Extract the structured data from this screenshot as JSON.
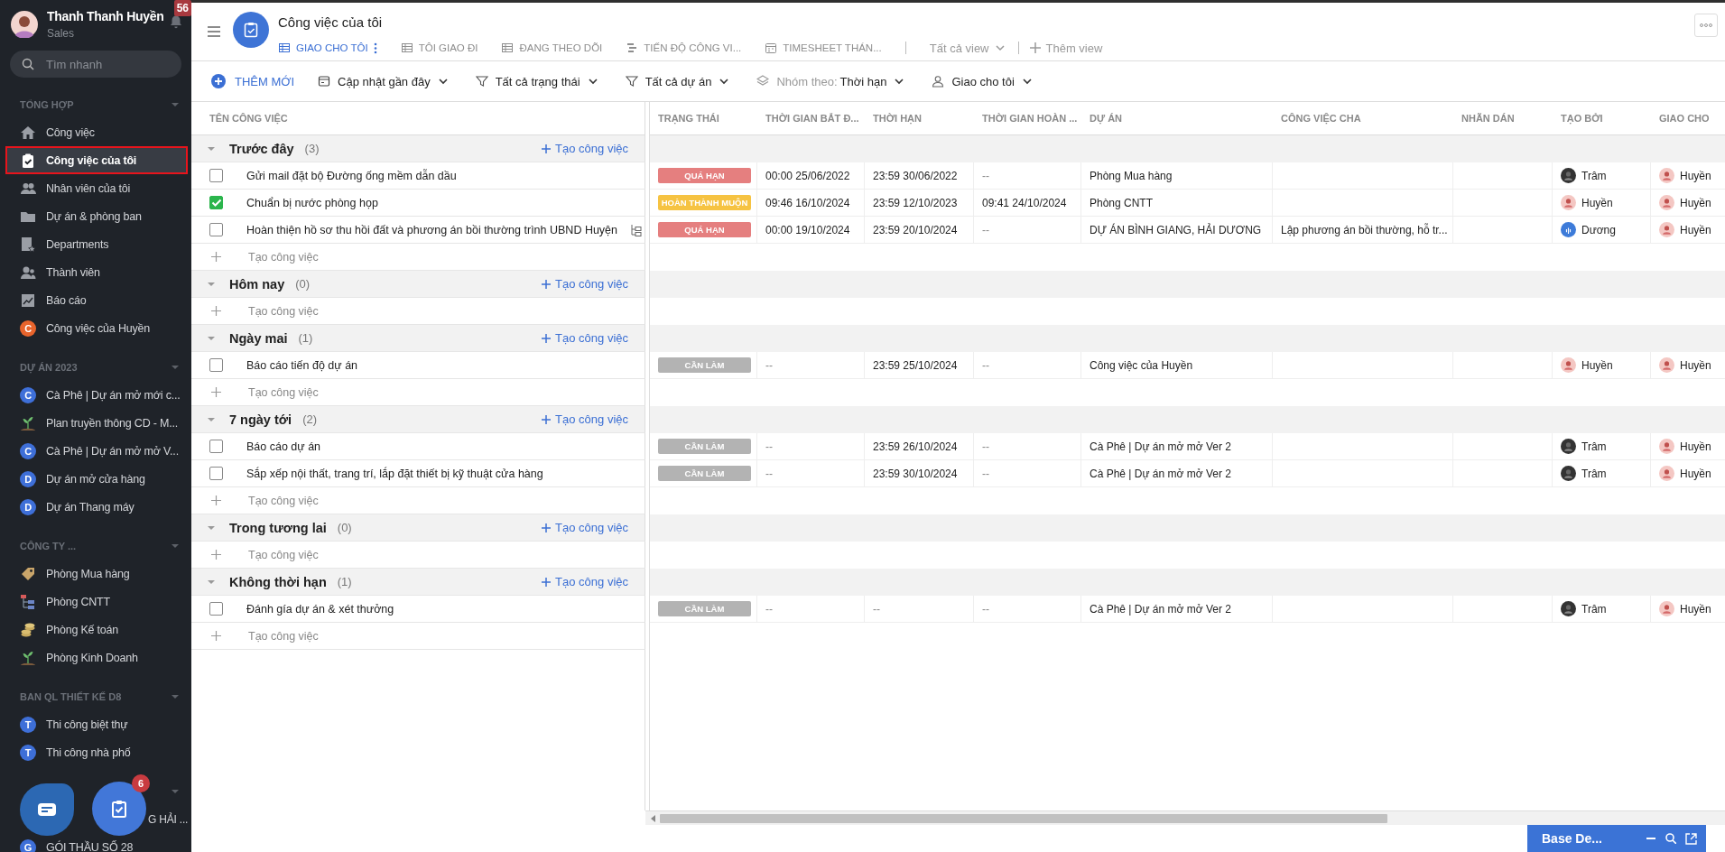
{
  "sidebar": {
    "user": {
      "name": "Thanh Thanh Huyền",
      "role": "Sales"
    },
    "notifications": "56",
    "search": {
      "placeholder": "Tìm nhanh"
    },
    "sections": [
      {
        "title": "TỔNG HỢP",
        "expanded": true,
        "items": [
          {
            "label": "Công việc",
            "kind": "home",
            "selected": false
          },
          {
            "label": "Công việc của tôi",
            "kind": "task",
            "selected": true
          },
          {
            "label": "Nhân viên của tôi",
            "kind": "people",
            "selected": false
          },
          {
            "label": "Dự án & phòng ban",
            "kind": "folder",
            "selected": false
          },
          {
            "label": "Departments",
            "kind": "dept",
            "selected": false
          },
          {
            "label": "Thành viên",
            "kind": "member",
            "selected": false
          },
          {
            "label": "Báo cáo",
            "kind": "report",
            "selected": false
          },
          {
            "label": "Công việc của Huyền",
            "kind": "letter",
            "badge": "C",
            "color": "#e8642c",
            "selected": false
          }
        ]
      },
      {
        "title": "DỰ ÁN 2023",
        "expanded": true,
        "items": [
          {
            "label": "Cà Phê | Dự án mở mới c...",
            "kind": "letter",
            "badge": "C",
            "color": "#3e6fd8",
            "selected": false
          },
          {
            "label": "Plan truyền thông CD - M...",
            "kind": "plant",
            "selected": false
          },
          {
            "label": "Cà Phê | Dự án mở mở V...",
            "kind": "letter",
            "badge": "C",
            "color": "#3e6fd8",
            "selected": false
          },
          {
            "label": "Dự án mở cửa hàng",
            "kind": "letter",
            "badge": "D",
            "color": "#3e6fd8",
            "selected": false
          },
          {
            "label": "Dự án Thang máy",
            "kind": "letter",
            "badge": "D",
            "color": "#3e6fd8",
            "selected": false
          }
        ]
      },
      {
        "title": "CÔNG TY ...",
        "expanded": true,
        "items": [
          {
            "label": "Phòng Mua hàng",
            "kind": "tag",
            "selected": false
          },
          {
            "label": "Phòng CNTT",
            "kind": "org",
            "selected": false
          },
          {
            "label": "Phòng Kế toán",
            "kind": "coins",
            "selected": false
          },
          {
            "label": "Phòng Kinh Doanh",
            "kind": "plant",
            "selected": false
          }
        ]
      },
      {
        "title": "BAN QL THIẾT KẾ D8",
        "expanded": true,
        "items": [
          {
            "label": "Thi công biệt thự",
            "kind": "letter",
            "badge": "T",
            "color": "#3e6fd8",
            "selected": false
          },
          {
            "label": "Thi công nhà phố",
            "kind": "letter",
            "badge": "T",
            "color": "#3e6fd8",
            "selected": false
          }
        ]
      },
      {
        "expanded": true,
        "items": [
          {
            "label": "G HẢI ...",
            "kind": "covered",
            "selected": false
          },
          {
            "label": "GÓI THẦU SỐ 28",
            "kind": "letter",
            "badge": "G",
            "color": "#3e6fd8",
            "selected": false
          }
        ]
      }
    ]
  },
  "floating": {
    "task_badge": "6"
  },
  "header": {
    "title": "Công việc của tôi",
    "tabs": [
      {
        "label": "GIAO CHO TÔI",
        "kind": "table",
        "selected": true
      },
      {
        "label": "TÔI GIAO ĐI",
        "kind": "table",
        "selected": false
      },
      {
        "label": "ĐANG THEO DÕI",
        "kind": "table",
        "selected": false
      },
      {
        "label": "TIẾN ĐỘ CÔNG VI...",
        "kind": "gantt",
        "selected": false
      },
      {
        "label": "TIMESHEET THÁN...",
        "kind": "calendar",
        "selected": false
      }
    ],
    "view_menu": "Tất cả view",
    "add_view": "Thêm view"
  },
  "toolbar": {
    "add_button": "THÊM MỚI",
    "filters": [
      {
        "kind": "calendar",
        "label": "Cập nhật gần đây"
      },
      {
        "kind": "filter",
        "label": "Tất cả trạng thái"
      },
      {
        "kind": "filter",
        "label": "Tất cả dự án"
      },
      {
        "kind": "group",
        "prefix": "Nhóm theo:",
        "label": "Thời hạn"
      },
      {
        "kind": "person",
        "label": "Giao cho tôi"
      }
    ]
  },
  "table": {
    "columns": [
      "TÊN CÔNG VIỆC",
      "TRẠNG THÁI",
      "THỜI GIAN BẮT Đ...",
      "THỜI HẠN",
      "THỜI GIAN HOÀN ...",
      "DỰ ÁN",
      "CÔNG VIỆC CHA",
      "NHÃN DÁN",
      "TẠO BỞI",
      "GIAO CHO"
    ],
    "groups": [
      {
        "title": "Trước đây",
        "count": "(3)",
        "expanded": true,
        "add_link": "Tạo công việc",
        "add_placeholder": "Tạo công việc",
        "tasks": [
          {
            "name": "Gửi mail đặt bộ Đường ống mềm dẫn dầu",
            "checked": false,
            "status": {
              "label": "QUÁ HẠN",
              "color": "#e57f7f"
            },
            "start": "00:00 25/06/2022",
            "deadline": "23:59 30/06/2022",
            "completed": "--",
            "project": "Phòng Mua hàng",
            "created_by": {
              "name": "Trâm",
              "color": "#333333"
            },
            "assignee": {
              "name": "Huyền",
              "color": "#f4c7c3"
            }
          },
          {
            "name": "Chuẩn bị nước phòng họp",
            "checked": true,
            "status": {
              "label": "HOÀN THÀNH MUỘN",
              "color": "#f6c342"
            },
            "start": "09:46 16/10/2024",
            "deadline": "23:59 12/10/2023",
            "completed": "09:41 24/10/2024",
            "project": "Phòng CNTT",
            "created_by": {
              "name": "Huyền",
              "color": "#f4c7c3"
            },
            "assignee": {
              "name": "Huyền",
              "color": "#f4c7c3"
            }
          },
          {
            "name": "Hoàn thiện hồ sơ thu hồi đất và phương án bồi thường trình UBND Huyện",
            "checked": false,
            "subtasks": true,
            "status": {
              "label": "QUÁ HẠN",
              "color": "#e57f7f"
            },
            "start": "00:00 19/10/2024",
            "deadline": "23:59 20/10/2024",
            "completed": "--",
            "project": "DỰ ÁN BÌNH GIANG, HẢI DƯƠNG",
            "parent": "Lập phương án bồi thường, hỗ tr...",
            "created_by": {
              "name": "Dương",
              "color": "#3d7bd9"
            },
            "assignee": {
              "name": "Huyền",
              "color": "#f4c7c3"
            }
          }
        ]
      },
      {
        "title": "Hôm nay",
        "count": "(0)",
        "expanded": true,
        "add_link": "Tạo công việc",
        "add_placeholder": "Tạo công việc"
      },
      {
        "title": "Ngày mai",
        "count": "(1)",
        "expanded": true,
        "add_link": "Tạo công việc",
        "add_placeholder": "Tạo công việc",
        "tasks": [
          {
            "name": "Báo cáo tiến độ dự án",
            "checked": false,
            "status": {
              "label": "CẦN LÀM",
              "color": "#b3b3b3"
            },
            "start": "--",
            "deadline": "23:59 25/10/2024",
            "completed": "--",
            "project": "Công việc của Huyền",
            "created_by": {
              "name": "Huyền",
              "color": "#f4c7c3"
            },
            "assignee": {
              "name": "Huyền",
              "color": "#f4c7c3"
            }
          }
        ]
      },
      {
        "title": "7 ngày tới",
        "count": "(2)",
        "expanded": true,
        "add_link": "Tạo công việc",
        "add_placeholder": "Tạo công việc",
        "tasks": [
          {
            "name": "Báo cáo dự án",
            "checked": false,
            "status": {
              "label": "CẦN LÀM",
              "color": "#b3b3b3"
            },
            "start": "--",
            "deadline": "23:59 26/10/2024",
            "completed": "--",
            "project": "Cà Phê | Dự án mở mở Ver 2",
            "created_by": {
              "name": "Trâm",
              "color": "#333333"
            },
            "assignee": {
              "name": "Huyền",
              "color": "#f4c7c3"
            }
          },
          {
            "name": "Sắp xếp nội thất, trang trí, lắp đặt thiết bị kỹ thuật cửa hàng",
            "checked": false,
            "status": {
              "label": "CẦN LÀM",
              "color": "#b3b3b3"
            },
            "start": "--",
            "deadline": "23:59 30/10/2024",
            "completed": "--",
            "project": "Cà Phê | Dự án mở mở Ver 2",
            "created_by": {
              "name": "Trâm",
              "color": "#333333"
            },
            "assignee": {
              "name": "Huyền",
              "color": "#f4c7c3"
            }
          }
        ]
      },
      {
        "title": "Trong tương lai",
        "count": "(0)",
        "expanded": true,
        "add_link": "Tạo công việc",
        "add_placeholder": "Tạo công việc"
      },
      {
        "title": "Không thời hạn",
        "count": "(1)",
        "expanded": true,
        "add_link": "Tạo công việc",
        "add_placeholder": "Tạo công việc",
        "tasks": [
          {
            "name": "Đánh gía dự án & xét thưởng",
            "checked": false,
            "status": {
              "label": "CẦN LÀM",
              "color": "#b3b3b3"
            },
            "start": "--",
            "deadline": "--",
            "completed": "--",
            "project": "Cà Phê | Dự án mở mở Ver 2",
            "created_by": {
              "name": "Trâm",
              "color": "#333333"
            },
            "assignee": {
              "name": "Huyền",
              "color": "#f4c7c3"
            }
          }
        ]
      }
    ]
  },
  "chat_widget": {
    "title": "Base De..."
  }
}
